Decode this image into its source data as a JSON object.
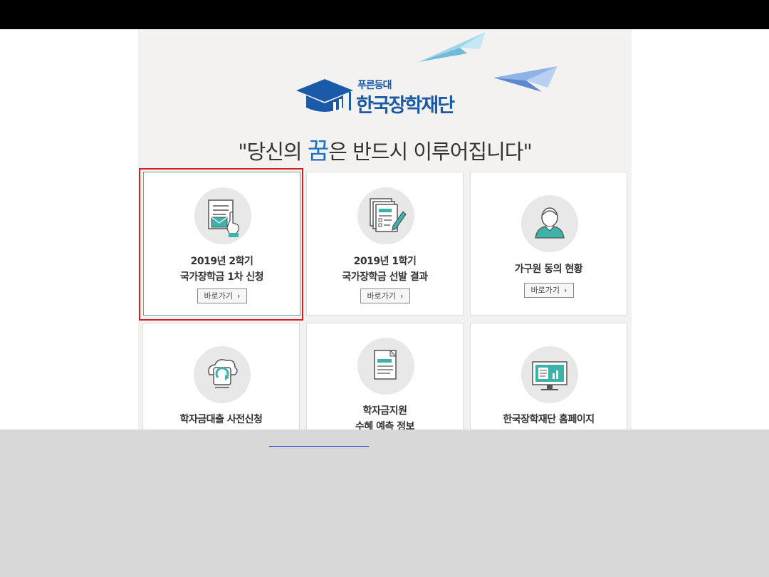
{
  "header": {
    "logo_sub": "푸른등대",
    "logo_name": "한국장학재단",
    "slogan_prefix": "\"당신의 ",
    "slogan_highlight": "꿈",
    "slogan_suffix": "은 반드시 이루어집니다\""
  },
  "cards": [
    {
      "line1": "2019년 2학기",
      "line2": "국가장학금 1차 신청",
      "button": "바로가기",
      "icon": "document-mail-hand-icon"
    },
    {
      "line1": "2019년 1학기",
      "line2": "국가장학금 선발 결과",
      "button": "바로가기",
      "icon": "documents-pencil-icon"
    },
    {
      "line1": "가구원 동의 현황",
      "button": "바로가기",
      "icon": "person-icon"
    },
    {
      "line1": "학자금대출 사전신청",
      "icon": "cloud-phone-sync-icon"
    },
    {
      "line1": "학자금지원",
      "line2": "수혜 예측 정보",
      "icon": "document-list-icon"
    },
    {
      "line1": "한국장학재단 홈페이지",
      "icon": "monitor-chart-icon"
    }
  ],
  "colors": {
    "brand": "#1a5aa8",
    "highlight_border": "#d71f1f",
    "link": "#1e3ee8"
  }
}
